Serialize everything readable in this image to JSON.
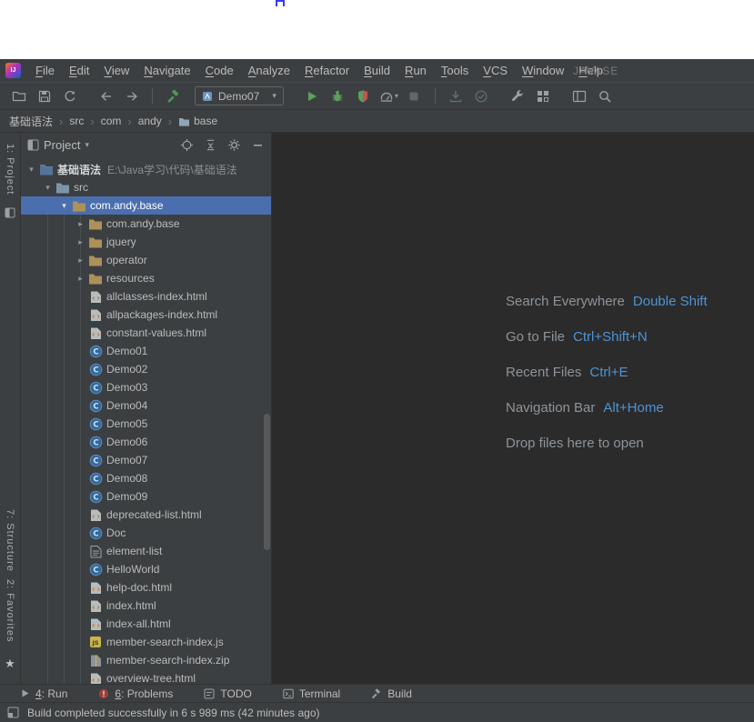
{
  "colors": {
    "panel_bg": "#3c3f41",
    "editor_bg": "#2b2b2b",
    "selection_blue": "#4b6eaf",
    "shortcut_blue": "#4e94d5",
    "run_green": "#5ba05e",
    "error_red": "#c75450"
  },
  "window": {
    "title": "JAVASE"
  },
  "menubar": {
    "items": [
      "File",
      "Edit",
      "View",
      "Navigate",
      "Code",
      "Analyze",
      "Refactor",
      "Build",
      "Run",
      "Tools",
      "VCS",
      "Window",
      "Help"
    ]
  },
  "toolbar": {
    "run_config": "Demo07"
  },
  "breadcrumbs": {
    "items": [
      {
        "label": "基础语法"
      },
      {
        "label": "src"
      },
      {
        "label": "com"
      },
      {
        "label": "andy"
      },
      {
        "label": "base",
        "icon": "folder"
      }
    ]
  },
  "tool_stripe": {
    "top": [
      "1: Project"
    ],
    "bottom": [
      "7: Structure",
      "2: Favorites"
    ]
  },
  "project_panel": {
    "title": "Project",
    "tree": [
      {
        "indent": 0,
        "chevron": "down",
        "icon": "project",
        "label": "基础语法",
        "annotation": "E:\\Java学习\\代码\\基础语法",
        "bold": true
      },
      {
        "indent": 1,
        "chevron": "down",
        "icon": "folder",
        "label": "src"
      },
      {
        "indent": 2,
        "chevron": "down",
        "icon": "package",
        "label": "com.andy.base",
        "selected": true
      },
      {
        "indent": 3,
        "chevron": "right",
        "icon": "package",
        "label": "com.andy.base"
      },
      {
        "indent": 3,
        "chevron": "right",
        "icon": "package",
        "label": "jquery"
      },
      {
        "indent": 3,
        "chevron": "right",
        "icon": "package",
        "label": "operator"
      },
      {
        "indent": 3,
        "chevron": "right",
        "icon": "package",
        "label": "resources"
      },
      {
        "indent": 3,
        "icon": "html",
        "label": "allclasses-index.html"
      },
      {
        "indent": 3,
        "icon": "html",
        "label": "allpackages-index.html"
      },
      {
        "indent": 3,
        "icon": "html",
        "label": "constant-values.html"
      },
      {
        "indent": 3,
        "icon": "class",
        "label": "Demo01"
      },
      {
        "indent": 3,
        "icon": "class",
        "label": "Demo02"
      },
      {
        "indent": 3,
        "icon": "class",
        "label": "Demo03"
      },
      {
        "indent": 3,
        "icon": "class",
        "label": "Demo04"
      },
      {
        "indent": 3,
        "icon": "class",
        "label": "Demo05"
      },
      {
        "indent": 3,
        "icon": "class",
        "label": "Demo06"
      },
      {
        "indent": 3,
        "icon": "class",
        "label": "Demo07"
      },
      {
        "indent": 3,
        "icon": "class",
        "label": "Demo08"
      },
      {
        "indent": 3,
        "icon": "class",
        "label": "Demo09"
      },
      {
        "indent": 3,
        "icon": "html",
        "label": "deprecated-list.html"
      },
      {
        "indent": 3,
        "icon": "class",
        "label": "Doc"
      },
      {
        "indent": 3,
        "icon": "file",
        "label": "element-list"
      },
      {
        "indent": 3,
        "icon": "class",
        "label": "HelloWorld"
      },
      {
        "indent": 3,
        "icon": "html",
        "label": "help-doc.html"
      },
      {
        "indent": 3,
        "icon": "html",
        "label": "index.html"
      },
      {
        "indent": 3,
        "icon": "html",
        "label": "index-all.html"
      },
      {
        "indent": 3,
        "icon": "js",
        "label": "member-search-index.js"
      },
      {
        "indent": 3,
        "icon": "zip",
        "label": "member-search-index.zip"
      },
      {
        "indent": 3,
        "icon": "html",
        "label": "overview-tree.html"
      }
    ]
  },
  "editor": {
    "shortcuts": [
      {
        "label": "Search Everywhere",
        "shortcut": "Double Shift"
      },
      {
        "label": "Go to File",
        "shortcut": "Ctrl+Shift+N"
      },
      {
        "label": "Recent Files",
        "shortcut": "Ctrl+E"
      },
      {
        "label": "Navigation Bar",
        "shortcut": "Alt+Home"
      },
      {
        "label": "Drop files here to open",
        "shortcut": ""
      }
    ]
  },
  "bottom_bar": {
    "items": [
      {
        "icon": "run",
        "label": "4: Run"
      },
      {
        "icon": "problems",
        "label": "6: Problems"
      },
      {
        "icon": "todo",
        "label": "TODO"
      },
      {
        "icon": "terminal",
        "label": "Terminal"
      },
      {
        "icon": "build",
        "label": "Build"
      }
    ]
  },
  "status_bar": {
    "message": "Build completed successfully in 6 s 989 ms (42 minutes ago)"
  }
}
